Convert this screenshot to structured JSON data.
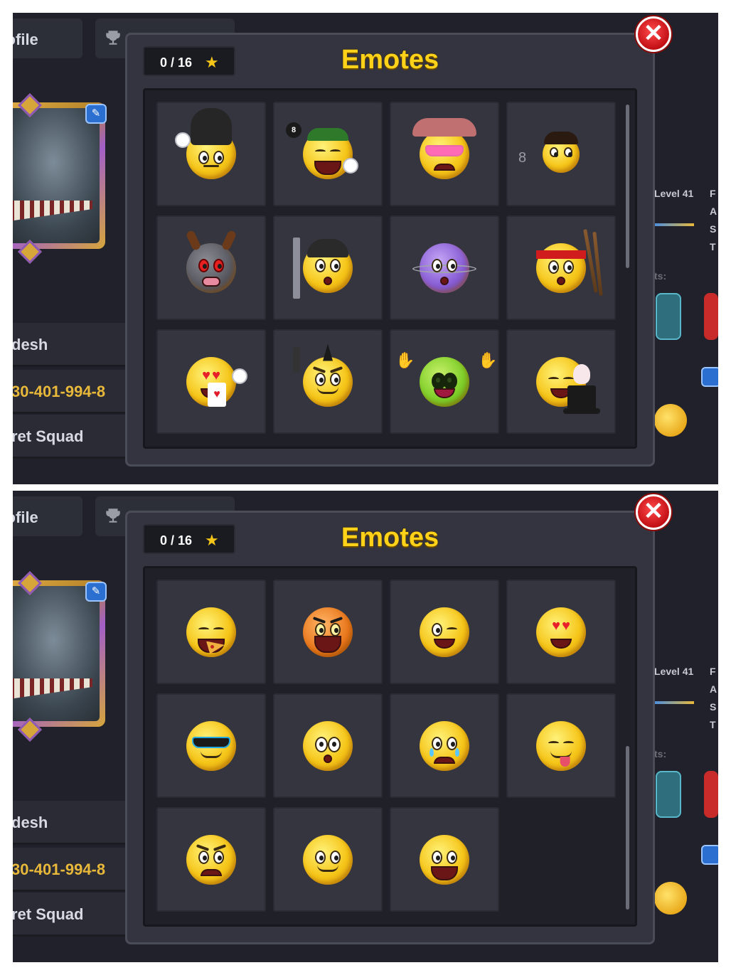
{
  "background": {
    "tab_profile_label": "rofile",
    "row_name": "desh",
    "row_id": "30-401-994-8",
    "row_club": "ret Squad",
    "level_label": "Level 41",
    "side_letters": "F A S T",
    "ts_label": "ts:"
  },
  "dialog": {
    "title": "Emotes",
    "counter": "0 / 16",
    "close_label": "✕"
  },
  "screens": [
    {
      "scroll_position": "top",
      "emotes": [
        {
          "name": "guard-bearskin-hat-emote"
        },
        {
          "name": "crying-8-ball-emote"
        },
        {
          "name": "cowgirl-sunglasses-emote"
        },
        {
          "name": "juggler-emote"
        },
        {
          "name": "bull-emote"
        },
        {
          "name": "beanie-peek-door-emote"
        },
        {
          "name": "purple-planet-emote"
        },
        {
          "name": "bandana-cues-emote"
        },
        {
          "name": "heart-eyes-card-emote"
        },
        {
          "name": "mohawk-rocker-emote"
        },
        {
          "name": "alien-emote"
        },
        {
          "name": "magician-bunny-emote"
        }
      ]
    },
    {
      "scroll_position": "bottom",
      "emotes": [
        {
          "name": "pizza-laugh-emote"
        },
        {
          "name": "tiger-roar-emote"
        },
        {
          "name": "wink-emote"
        },
        {
          "name": "heart-eyes-emote"
        },
        {
          "name": "sunglasses-cool-emote"
        },
        {
          "name": "surprised-emote"
        },
        {
          "name": "crying-emote"
        },
        {
          "name": "tongue-out-emote"
        },
        {
          "name": "angry-emote"
        },
        {
          "name": "smile-emote"
        },
        {
          "name": "grin-emote"
        }
      ]
    }
  ],
  "colors": {
    "title": "#ffd21a",
    "star": "#f5c518",
    "close": "#c20f14",
    "dialog_bg": "#33343f"
  }
}
